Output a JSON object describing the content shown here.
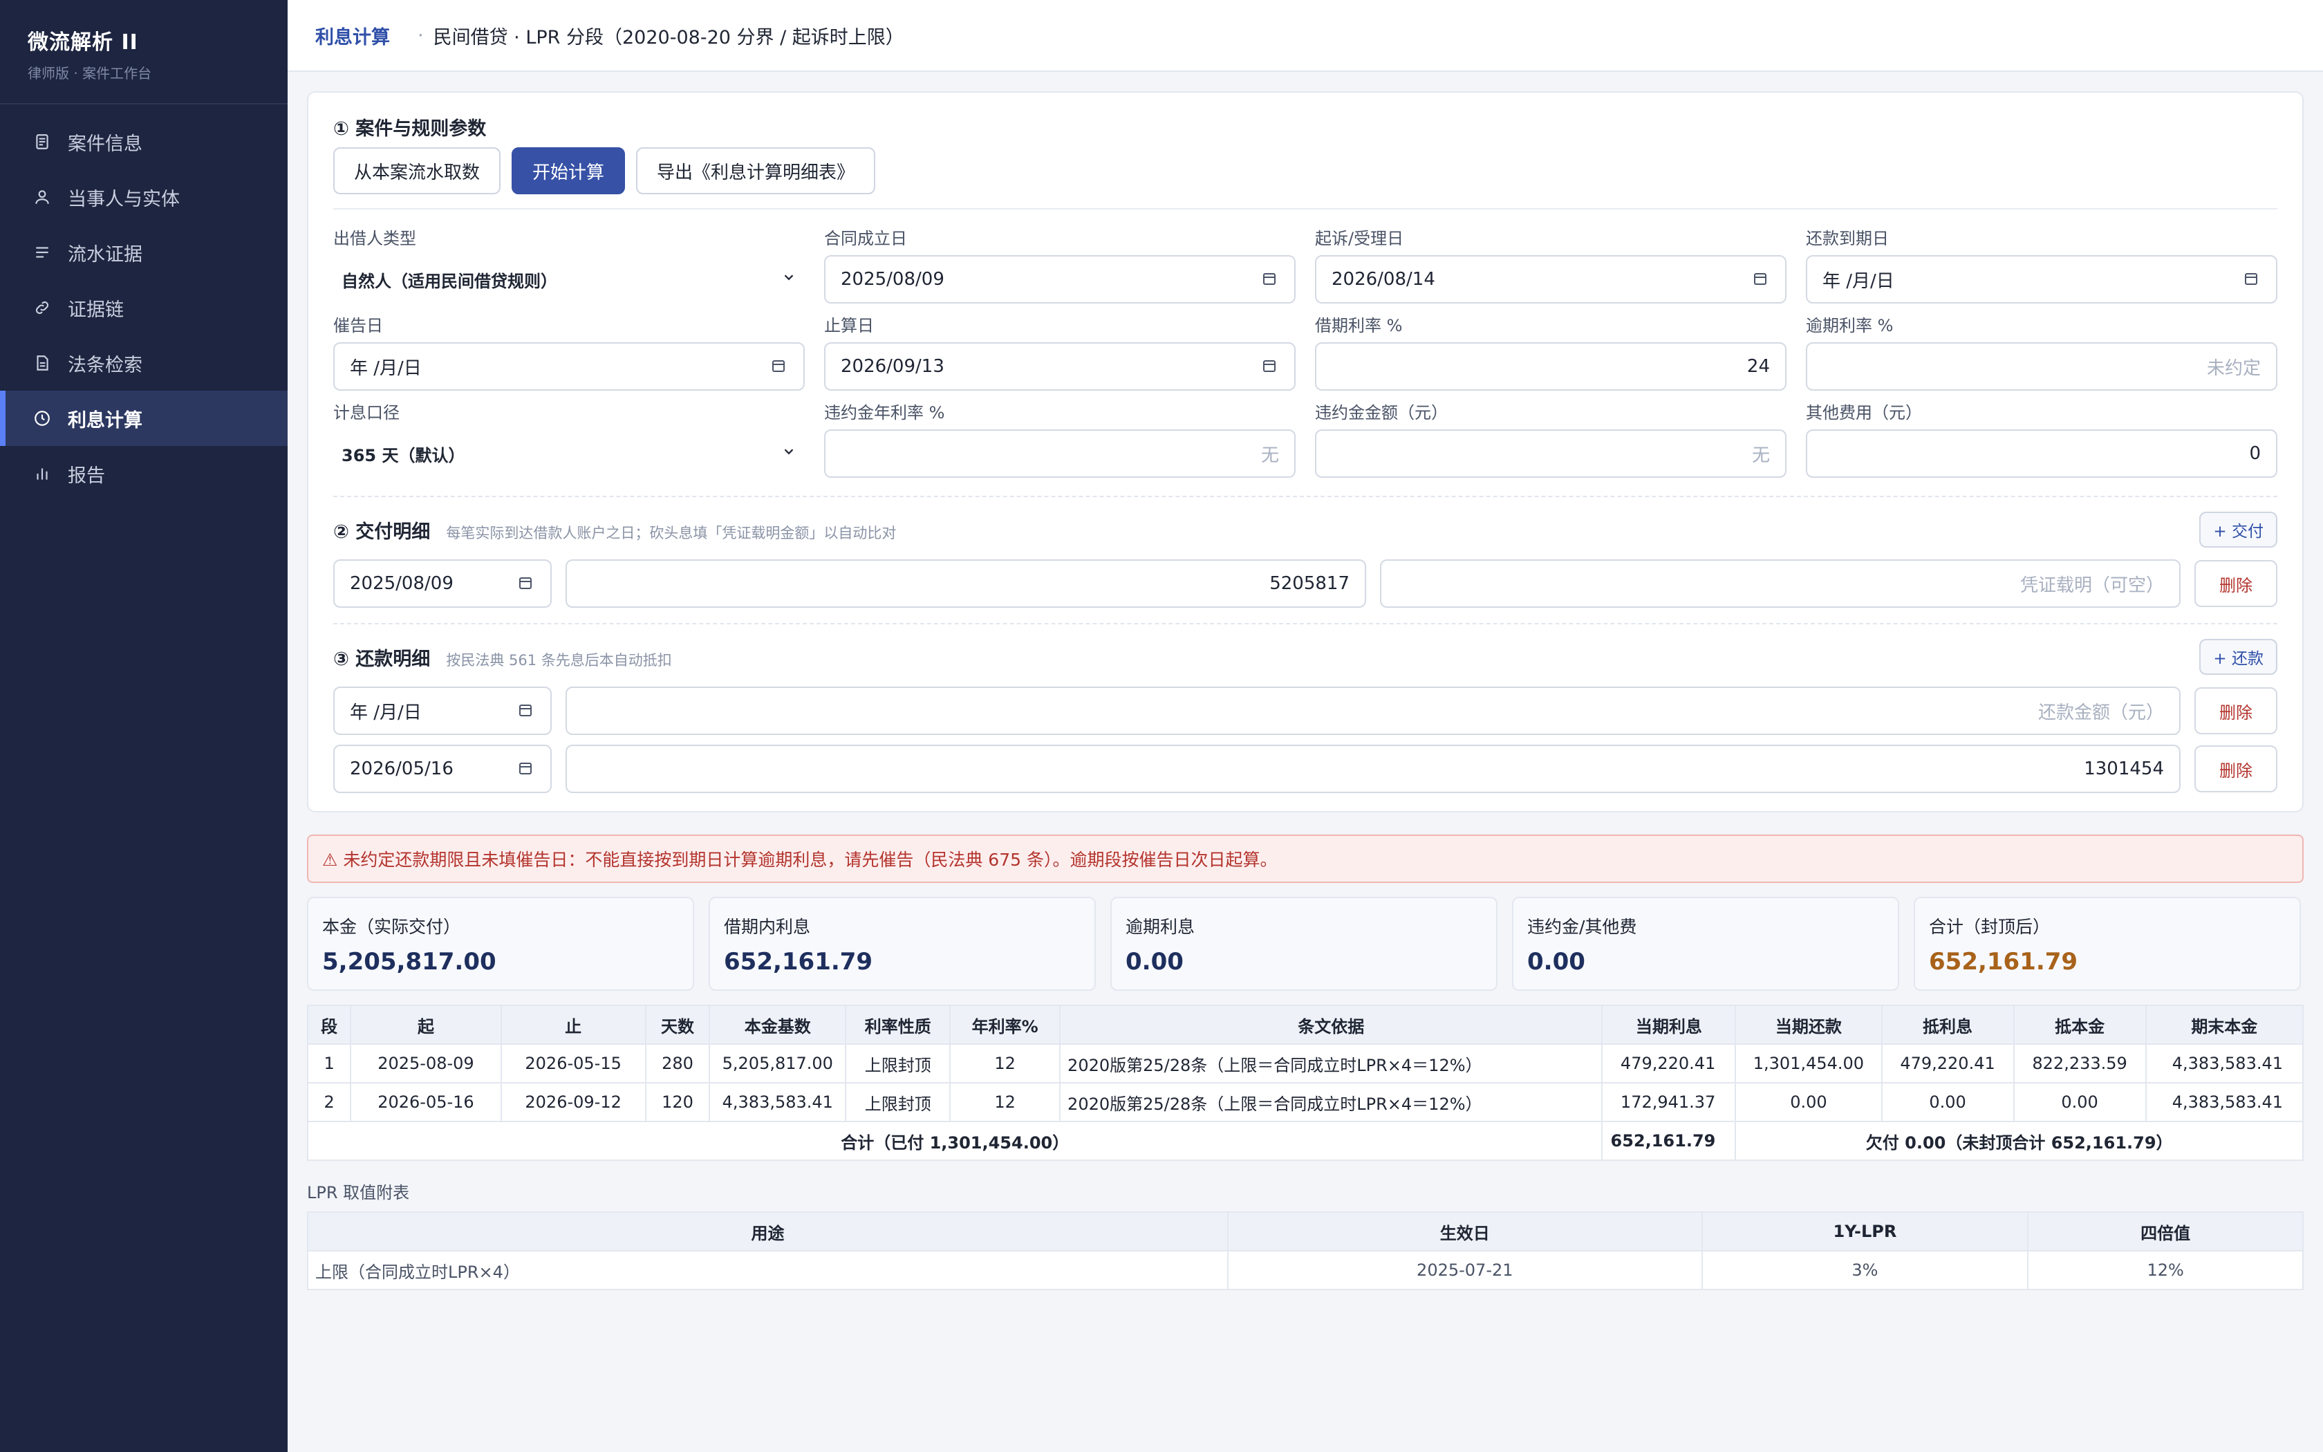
{
  "app": {
    "name": "微流解析 II",
    "subtitle": "律师版 · 案件工作台"
  },
  "sidebar": {
    "items": [
      {
        "label": "案件信息",
        "icon": "document-icon"
      },
      {
        "label": "当事人与实体",
        "icon": "user-icon"
      },
      {
        "label": "流水证据",
        "icon": "list-icon"
      },
      {
        "label": "证据链",
        "icon": "link-icon"
      },
      {
        "label": "法条检索",
        "icon": "file-icon"
      },
      {
        "label": "利息计算",
        "icon": "clock-icon",
        "active": true
      },
      {
        "label": "报告",
        "icon": "bar-chart-icon"
      }
    ]
  },
  "topbar": {
    "title": "利息计算",
    "sep": "·",
    "subtitle": "民间借贷 · LPR 分段（2020-08-20 分界 / 起诉时上限）"
  },
  "section1": {
    "title": "① 案件与规则参数",
    "buttons": {
      "fetch": "从本案流水取数",
      "calc": "开始计算",
      "export": "导出《利息计算明细表》"
    },
    "fields": {
      "lender_type": {
        "label": "出借人类型",
        "value": "自然人（适用民间借贷规则）"
      },
      "contract_date": {
        "label": "合同成立日",
        "value": "2025/08/09"
      },
      "suit_date": {
        "label": "起诉/受理日",
        "value": "2026/08/14"
      },
      "due_date": {
        "label": "还款到期日",
        "value": "年 /月/日"
      },
      "demand_date": {
        "label": "催告日",
        "value": "年 /月/日"
      },
      "end_date": {
        "label": "止算日",
        "value": "2026/09/13"
      },
      "rate": {
        "label": "借期利率 %",
        "value": "24"
      },
      "overdue_rate": {
        "label": "逾期利率 %",
        "placeholder": "未约定"
      },
      "basis": {
        "label": "计息口径",
        "value": "365 天（默认）"
      },
      "penalty_rate": {
        "label": "违约金年利率 %",
        "placeholder": "无"
      },
      "penalty_amount": {
        "label": "违约金金额（元）",
        "placeholder": "无"
      },
      "other_fee": {
        "label": "其他费用（元）",
        "value": "0"
      }
    }
  },
  "section2": {
    "title": "② 交付明细",
    "hint": "每笔实际到达借款人账户之日；砍头息填「凭证载明金额」以自动比对",
    "add_label": "+ 交付",
    "rows": [
      {
        "date": "2025/08/09",
        "amount": "5205817",
        "voucher_placeholder": "凭证载明（可空）",
        "del": "删除"
      }
    ]
  },
  "section3": {
    "title": "③ 还款明细",
    "hint": "按民法典 561 条先息后本自动抵扣",
    "add_label": "+ 还款",
    "rows": [
      {
        "date": "年 /月/日",
        "amount_placeholder": "还款金额（元）",
        "amount": "",
        "del": "删除"
      },
      {
        "date": "2026/05/16",
        "amount": "1301454",
        "del": "删除"
      }
    ]
  },
  "alert": "⚠ 未约定还款期限且未填催告日：不能直接按到期日计算逾期利息，请先催告（民法典 675 条）。逾期段按催告日次日起算。",
  "stats": [
    {
      "label": "本金（实际交付）",
      "value": "5,205,817.00"
    },
    {
      "label": "借期内利息",
      "value": "652,161.79"
    },
    {
      "label": "逾期利息",
      "value": "0.00"
    },
    {
      "label": "违约金/其他费",
      "value": "0.00"
    },
    {
      "label": "合计（封顶后）",
      "value": "652,161.79",
      "accent": "#a8621a"
    }
  ],
  "table": {
    "headers": [
      "段",
      "起",
      "止",
      "天数",
      "本金基数",
      "利率性质",
      "年利率%",
      "条文依据",
      "当期利息",
      "当期还款",
      "抵利息",
      "抵本金",
      "期末本金"
    ],
    "rows": [
      [
        "1",
        "2025-08-09",
        "2026-05-15",
        "280",
        "5,205,817.00",
        "上限封顶",
        "12",
        "2020版第25/28条（上限＝合同成立时LPR×4＝12%）",
        "479,220.41",
        "1,301,454.00",
        "479,220.41",
        "822,233.59",
        "4,383,583.41"
      ],
      [
        "2",
        "2026-05-16",
        "2026-09-12",
        "120",
        "4,383,583.41",
        "上限封顶",
        "12",
        "2020版第25/28条（上限＝合同成立时LPR×4＝12%）",
        "172,941.37",
        "0.00",
        "0.00",
        "0.00",
        "4,383,583.41"
      ]
    ],
    "total_label": "合计（已付 1,301,454.00）",
    "total_interest": "652,161.79",
    "total_tail": "欠付 0.00（未封顶合计 652,161.79）"
  },
  "lpr": {
    "title": "LPR 取值附表",
    "headers": [
      "用途",
      "生效日",
      "1Y-LPR",
      "四倍值"
    ],
    "rows": [
      [
        "上限（合同成立时LPR×4）",
        "2025-07-21",
        "3%",
        "12%"
      ]
    ]
  },
  "colors": {
    "sidebar": "#1d2540",
    "primary": "#3651a6",
    "alert": "#b3342d",
    "accent": "#a8621a"
  }
}
